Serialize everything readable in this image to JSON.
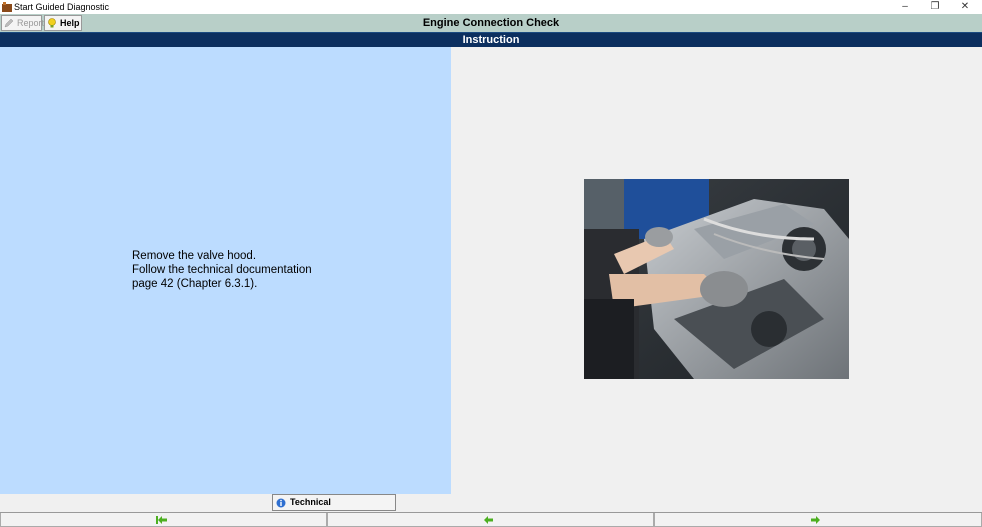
{
  "window": {
    "title": "Start Guided Diagnostic"
  },
  "toolbar": {
    "report_label": "Report",
    "help_label": "Help"
  },
  "header": {
    "page_title": "Engine Connection Check",
    "section_title": "Instruction"
  },
  "instruction": {
    "text": "Remove the valve hood.\nFollow the technical documentation\npage 42 (Chapter 6.3.1)."
  },
  "footer": {
    "techdoc_label": "Technical Documentation"
  },
  "navigation": {
    "buttons": [
      "first-step",
      "previous-step",
      "next-step"
    ]
  },
  "colors": {
    "toolbar": "#b8cfc8",
    "section_bar": "#0c2f5f",
    "instruction_panel": "#bcdcff",
    "nav_arrow": "#4caf20"
  }
}
